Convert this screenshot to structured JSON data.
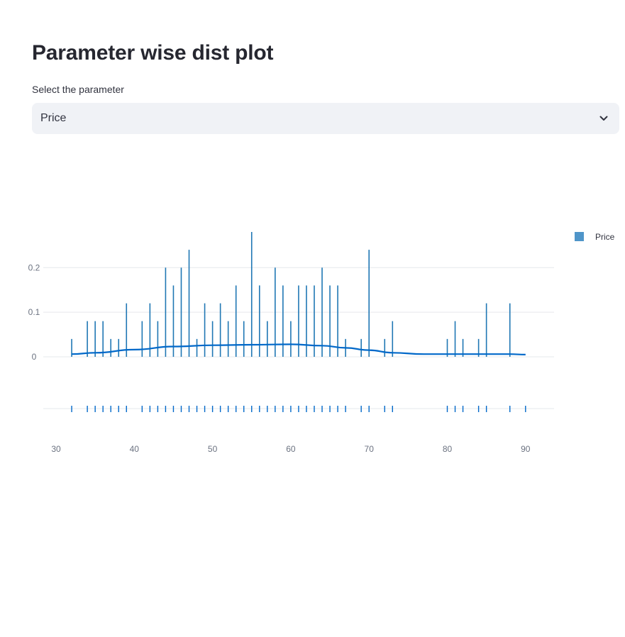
{
  "page": {
    "title": "Parameter wise dist plot",
    "select_label": "Select the parameter",
    "selected_value": "Price"
  },
  "icons": {
    "dropdown": "chevron-down-icon"
  },
  "colors": {
    "series": "#1f77b4",
    "kde": "#0068c9",
    "legend_swatch": "#4f95c9"
  },
  "chart_data": {
    "type": "histogram",
    "title": "",
    "xlabel": "",
    "ylabel": "",
    "xlim": [
      29,
      94
    ],
    "ylim": [
      0,
      0.28
    ],
    "x_ticks": [
      30,
      40,
      50,
      60,
      70,
      80,
      90
    ],
    "y_ticks": [
      0,
      0.1,
      0.2
    ],
    "y_tick_labels": [
      "0",
      "0.1",
      "0.2"
    ],
    "legend": {
      "position": "top-right",
      "entries": [
        "Price"
      ]
    },
    "series": [
      {
        "name": "Price",
        "bars": {
          "x": [
            32,
            34,
            35,
            36,
            37,
            38,
            39,
            41,
            42,
            43,
            44,
            45,
            46,
            47,
            48,
            49,
            50,
            51,
            52,
            53,
            54,
            55,
            56,
            57,
            58,
            59,
            60,
            61,
            62,
            63,
            64,
            65,
            66,
            67,
            69,
            70,
            72,
            73,
            80,
            81,
            82,
            84,
            85,
            88
          ],
          "y": [
            0.04,
            0.08,
            0.08,
            0.08,
            0.04,
            0.04,
            0.12,
            0.08,
            0.12,
            0.08,
            0.2,
            0.16,
            0.2,
            0.24,
            0.04,
            0.12,
            0.08,
            0.12,
            0.08,
            0.16,
            0.08,
            0.28,
            0.16,
            0.08,
            0.2,
            0.16,
            0.08,
            0.16,
            0.16,
            0.16,
            0.2,
            0.16,
            0.16,
            0.04,
            0.04,
            0.24,
            0.04,
            0.08,
            0.04,
            0.08,
            0.04,
            0.04,
            0.12,
            0.12
          ]
        },
        "kde": {
          "x": [
            32,
            35,
            40,
            45,
            50,
            55,
            60,
            64,
            67,
            70,
            73,
            77,
            80,
            85,
            88,
            90
          ],
          "y": [
            0.006,
            0.009,
            0.016,
            0.023,
            0.026,
            0.027,
            0.028,
            0.025,
            0.02,
            0.015,
            0.009,
            0.006,
            0.006,
            0.006,
            0.006,
            0.005
          ]
        },
        "rug": [
          32,
          34,
          35,
          36,
          37,
          38,
          39,
          41,
          42,
          43,
          44,
          45,
          46,
          47,
          48,
          49,
          50,
          51,
          52,
          53,
          54,
          55,
          56,
          57,
          58,
          59,
          60,
          61,
          62,
          63,
          64,
          65,
          66,
          67,
          69,
          70,
          72,
          73,
          80,
          81,
          82,
          84,
          85,
          88,
          90
        ]
      }
    ]
  }
}
